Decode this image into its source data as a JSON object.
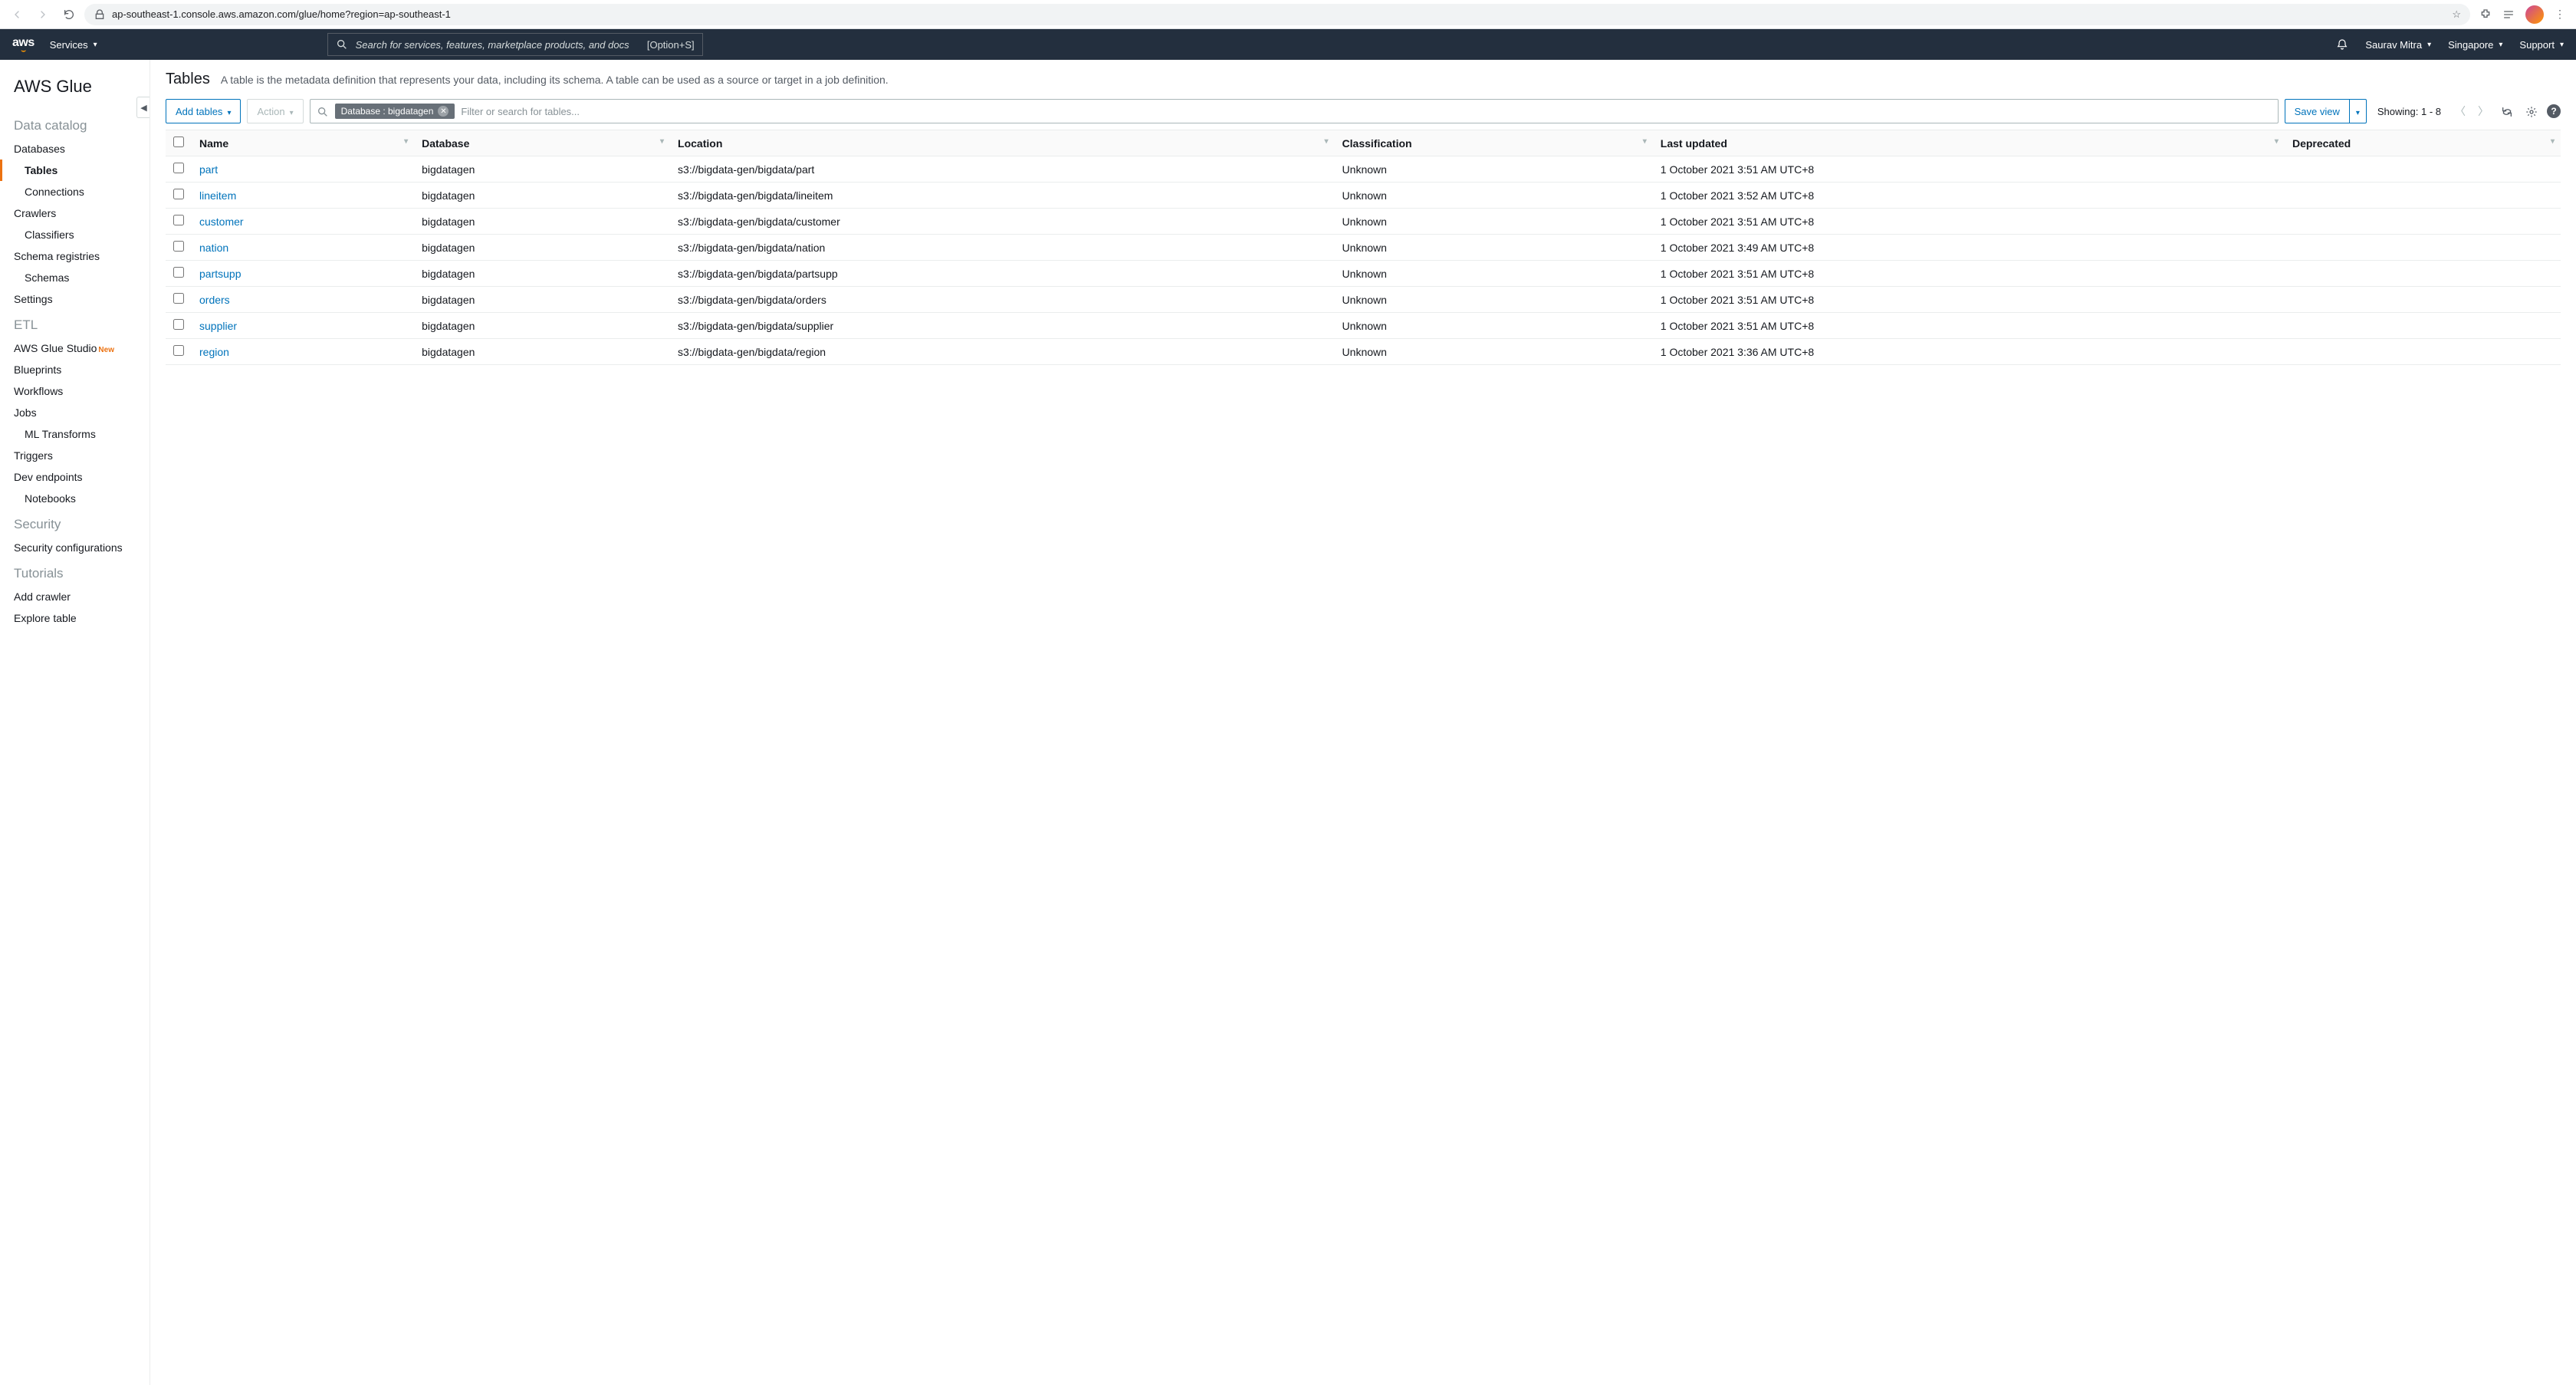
{
  "browser": {
    "url": "ap-southeast-1.console.aws.amazon.com/glue/home?region=ap-southeast-1"
  },
  "awsNav": {
    "services": "Services",
    "searchPlaceholder": "Search for services, features, marketplace products, and docs",
    "searchShortcut": "[Option+S]",
    "user": "Saurav Mitra",
    "region": "Singapore",
    "support": "Support"
  },
  "sidebar": {
    "serviceTitle": "AWS Glue",
    "sections": {
      "dataCatalog": "Data catalog",
      "etl": "ETL",
      "security": "Security",
      "tutorials": "Tutorials"
    },
    "items": {
      "databases": "Databases",
      "tables": "Tables",
      "connections": "Connections",
      "crawlers": "Crawlers",
      "classifiers": "Classifiers",
      "schemaRegistries": "Schema registries",
      "schemas": "Schemas",
      "settings": "Settings",
      "glueStudio": "AWS Glue Studio",
      "newBadge": "New",
      "blueprints": "Blueprints",
      "workflows": "Workflows",
      "jobs": "Jobs",
      "mlTransforms": "ML Transforms",
      "triggers": "Triggers",
      "devEndpoints": "Dev endpoints",
      "notebooks": "Notebooks",
      "securityConfigs": "Security configurations",
      "addCrawler": "Add crawler",
      "exploreTable": "Explore table"
    }
  },
  "page": {
    "title": "Tables",
    "description": "A table is the metadata definition that represents your data, including its schema. A table can be used as a source or target in a job definition."
  },
  "toolbar": {
    "addTables": "Add tables",
    "action": "Action",
    "filterChip": "Database : bigdatagen",
    "filterPlaceholder": "Filter or search for tables...",
    "saveView": "Save view",
    "showing": "Showing: 1 - 8"
  },
  "table": {
    "headers": {
      "name": "Name",
      "database": "Database",
      "location": "Location",
      "classification": "Classification",
      "lastUpdated": "Last updated",
      "deprecated": "Deprecated"
    },
    "rows": [
      {
        "name": "part",
        "database": "bigdatagen",
        "location": "s3://bigdata-gen/bigdata/part",
        "classification": "Unknown",
        "lastUpdated": "1 October 2021 3:51 AM UTC+8",
        "deprecated": ""
      },
      {
        "name": "lineitem",
        "database": "bigdatagen",
        "location": "s3://bigdata-gen/bigdata/lineitem",
        "classification": "Unknown",
        "lastUpdated": "1 October 2021 3:52 AM UTC+8",
        "deprecated": ""
      },
      {
        "name": "customer",
        "database": "bigdatagen",
        "location": "s3://bigdata-gen/bigdata/customer",
        "classification": "Unknown",
        "lastUpdated": "1 October 2021 3:51 AM UTC+8",
        "deprecated": ""
      },
      {
        "name": "nation",
        "database": "bigdatagen",
        "location": "s3://bigdata-gen/bigdata/nation",
        "classification": "Unknown",
        "lastUpdated": "1 October 2021 3:49 AM UTC+8",
        "deprecated": ""
      },
      {
        "name": "partsupp",
        "database": "bigdatagen",
        "location": "s3://bigdata-gen/bigdata/partsupp",
        "classification": "Unknown",
        "lastUpdated": "1 October 2021 3:51 AM UTC+8",
        "deprecated": ""
      },
      {
        "name": "orders",
        "database": "bigdatagen",
        "location": "s3://bigdata-gen/bigdata/orders",
        "classification": "Unknown",
        "lastUpdated": "1 October 2021 3:51 AM UTC+8",
        "deprecated": ""
      },
      {
        "name": "supplier",
        "database": "bigdatagen",
        "location": "s3://bigdata-gen/bigdata/supplier",
        "classification": "Unknown",
        "lastUpdated": "1 October 2021 3:51 AM UTC+8",
        "deprecated": ""
      },
      {
        "name": "region",
        "database": "bigdatagen",
        "location": "s3://bigdata-gen/bigdata/region",
        "classification": "Unknown",
        "lastUpdated": "1 October 2021 3:36 AM UTC+8",
        "deprecated": ""
      }
    ]
  }
}
